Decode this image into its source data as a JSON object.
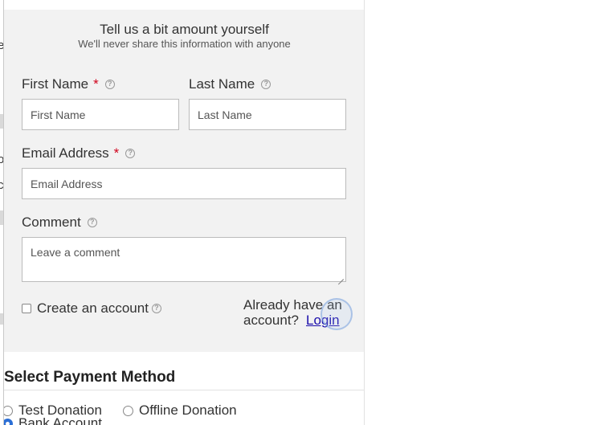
{
  "form": {
    "heading": "Tell us a bit amount yourself",
    "subheading": "We'll never share this information with anyone",
    "first_name": {
      "label": "First Name",
      "required_mark": "*",
      "placeholder": "First Name"
    },
    "last_name": {
      "label": "Last Name",
      "placeholder": "Last Name"
    },
    "email": {
      "label": "Email Address",
      "required_mark": "*",
      "placeholder": "Email Address"
    },
    "comment": {
      "label": "Comment",
      "placeholder": "Leave a comment"
    },
    "create_account": {
      "label": "Create an account",
      "checked": false
    },
    "login_prompt": {
      "line1": "Already have an",
      "line2": "account?",
      "link": "Login"
    },
    "help_icon_glyph": "?"
  },
  "payment": {
    "title": "Select Payment Method",
    "options": [
      {
        "label": "Test Donation",
        "selected": false
      },
      {
        "label": "Offline Donation",
        "selected": false
      },
      {
        "label": "Bank Account",
        "selected": true
      }
    ]
  },
  "left_edge": {
    "chars": [
      "e",
      "o",
      "c"
    ]
  },
  "colors": {
    "required": "#d0021b",
    "link": "#1a0dab",
    "panel_bg": "#f2f2f2",
    "radio_checked": "#2b6fd6"
  }
}
